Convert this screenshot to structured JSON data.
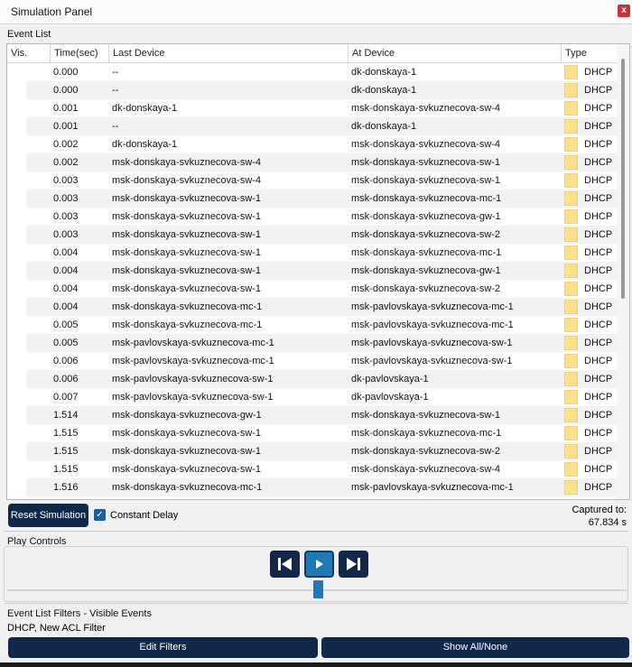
{
  "window": {
    "title": "Simulation Panel",
    "close_label": "x"
  },
  "event_list": {
    "label": "Event List",
    "columns": [
      "Vis.",
      "Time(sec)",
      "Last Device",
      "At Device",
      "Type"
    ],
    "rows": [
      {
        "time": "0.000",
        "last": "--",
        "at": "dk-donskaya-1",
        "type": "DHCP"
      },
      {
        "time": "0.000",
        "last": "--",
        "at": "dk-donskaya-1",
        "type": "DHCP"
      },
      {
        "time": "0.001",
        "last": "dk-donskaya-1",
        "at": "msk-donskaya-svkuznecova-sw-4",
        "type": "DHCP"
      },
      {
        "time": "0.001",
        "last": "--",
        "at": "dk-donskaya-1",
        "type": "DHCP"
      },
      {
        "time": "0.002",
        "last": "dk-donskaya-1",
        "at": "msk-donskaya-svkuznecova-sw-4",
        "type": "DHCP"
      },
      {
        "time": "0.002",
        "last": "msk-donskaya-svkuznecova-sw-4",
        "at": "msk-donskaya-svkuznecova-sw-1",
        "type": "DHCP"
      },
      {
        "time": "0.003",
        "last": "msk-donskaya-svkuznecova-sw-4",
        "at": "msk-donskaya-svkuznecova-sw-1",
        "type": "DHCP"
      },
      {
        "time": "0.003",
        "last": "msk-donskaya-svkuznecova-sw-1",
        "at": "msk-donskaya-svkuznecova-mc-1",
        "type": "DHCP"
      },
      {
        "time": "0.003",
        "last": "msk-donskaya-svkuznecova-sw-1",
        "at": "msk-donskaya-svkuznecova-gw-1",
        "type": "DHCP"
      },
      {
        "time": "0.003",
        "last": "msk-donskaya-svkuznecova-sw-1",
        "at": "msk-donskaya-svkuznecova-sw-2",
        "type": "DHCP"
      },
      {
        "time": "0.004",
        "last": "msk-donskaya-svkuznecova-sw-1",
        "at": "msk-donskaya-svkuznecova-mc-1",
        "type": "DHCP"
      },
      {
        "time": "0.004",
        "last": "msk-donskaya-svkuznecova-sw-1",
        "at": "msk-donskaya-svkuznecova-gw-1",
        "type": "DHCP"
      },
      {
        "time": "0.004",
        "last": "msk-donskaya-svkuznecova-sw-1",
        "at": "msk-donskaya-svkuznecova-sw-2",
        "type": "DHCP"
      },
      {
        "time": "0.004",
        "last": "msk-donskaya-svkuznecova-mc-1",
        "at": "msk-pavlovskaya-svkuznecova-mc-1",
        "type": "DHCP"
      },
      {
        "time": "0.005",
        "last": "msk-donskaya-svkuznecova-mc-1",
        "at": "msk-pavlovskaya-svkuznecova-mc-1",
        "type": "DHCP"
      },
      {
        "time": "0.005",
        "last": "msk-pavlovskaya-svkuznecova-mc-1",
        "at": "msk-pavlovskaya-svkuznecova-sw-1",
        "type": "DHCP"
      },
      {
        "time": "0.006",
        "last": "msk-pavlovskaya-svkuznecova-mc-1",
        "at": "msk-pavlovskaya-svkuznecova-sw-1",
        "type": "DHCP"
      },
      {
        "time": "0.006",
        "last": "msk-pavlovskaya-svkuznecova-sw-1",
        "at": "dk-pavlovskaya-1",
        "type": "DHCP"
      },
      {
        "time": "0.007",
        "last": "msk-pavlovskaya-svkuznecova-sw-1",
        "at": "dk-pavlovskaya-1",
        "type": "DHCP"
      },
      {
        "time": "1.514",
        "last": "msk-donskaya-svkuznecova-gw-1",
        "at": "msk-donskaya-svkuznecova-sw-1",
        "type": "DHCP"
      },
      {
        "time": "1.515",
        "last": "msk-donskaya-svkuznecova-sw-1",
        "at": "msk-donskaya-svkuznecova-mc-1",
        "type": "DHCP"
      },
      {
        "time": "1.515",
        "last": "msk-donskaya-svkuznecova-sw-1",
        "at": "msk-donskaya-svkuznecova-sw-2",
        "type": "DHCP"
      },
      {
        "time": "1.515",
        "last": "msk-donskaya-svkuznecova-sw-1",
        "at": "msk-donskaya-svkuznecova-sw-4",
        "type": "DHCP"
      },
      {
        "time": "1.516",
        "last": "msk-donskaya-svkuznecova-mc-1",
        "at": "msk-pavlovskaya-svkuznecova-mc-1",
        "type": "DHCP"
      }
    ],
    "type_color": "#fbe28a"
  },
  "controls": {
    "reset_label": "Reset Simulation",
    "constant_delay_label": "Constant Delay",
    "constant_delay_checked": true,
    "captured_label": "Captured to:",
    "captured_value": "67.834 s"
  },
  "play_controls": {
    "label": "Play Controls",
    "buttons": [
      "skip-back-icon",
      "play-icon",
      "skip-forward-icon"
    ]
  },
  "filters": {
    "label": "Event List Filters - Visible Events",
    "visible": "DHCP, New ACL Filter",
    "edit_label": "Edit Filters",
    "show_all_label": "Show All/None"
  },
  "colors": {
    "accent": "#12284a",
    "play": "#1e79b5",
    "close": "#c0363c"
  }
}
